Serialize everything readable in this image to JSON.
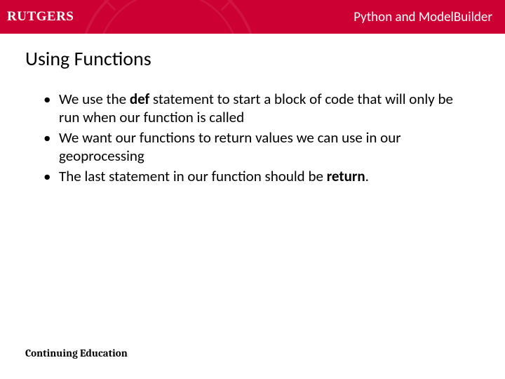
{
  "header": {
    "logo_text": "RUTGERS",
    "title": "Python and ModelBuilder"
  },
  "slide": {
    "title": "Using Functions"
  },
  "bullets": [
    {
      "pre": "We use the ",
      "bold": "def",
      "post": " statement to start a block of code that will only be run when our function is called"
    },
    {
      "pre": "We want our functions to return values we can use in our geoprocessing",
      "bold": "",
      "post": ""
    },
    {
      "pre": "The last statement in our function should be ",
      "bold": "return",
      "post": "."
    }
  ],
  "footer": {
    "text": "Continuing Education"
  }
}
